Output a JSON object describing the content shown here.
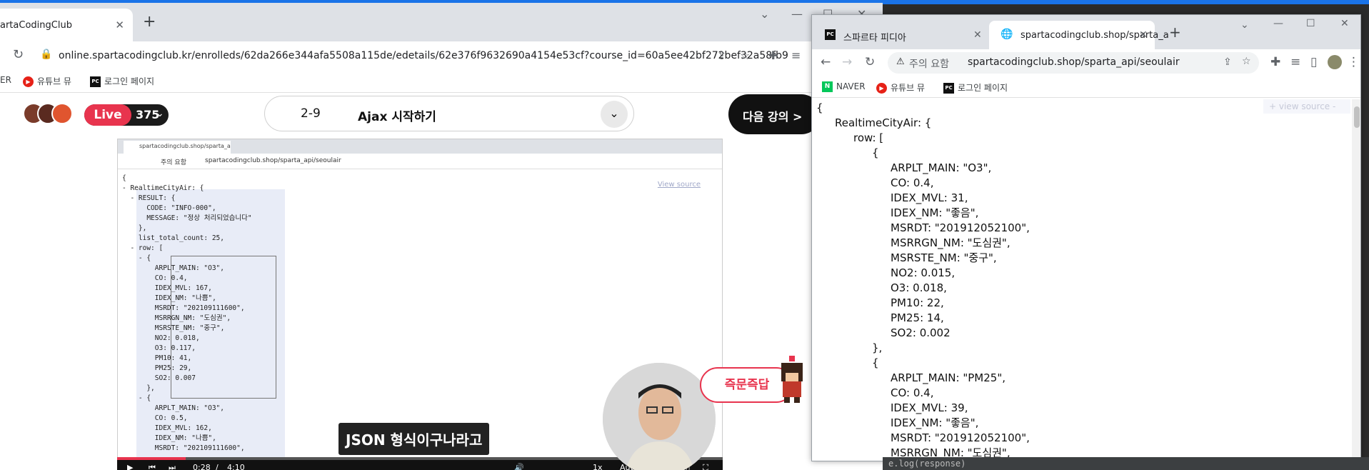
{
  "left_browser": {
    "tab_title": "artaCodingClub",
    "url": "online.spartacodingclub.kr/enrolleds/62da266e344afa5508a115de/edetails/62e376f9632690a4154e53cf?course_id=60a5ee42bf272bef32a58fb9",
    "bookmarks": [
      "ER",
      "유튜브 뮤",
      "로그인 페이지"
    ],
    "live_label": "Live",
    "live_count": "375",
    "lesson_number": "2-9",
    "lesson_title": "Ajax 시작하기",
    "next_button": "다음 강의 >",
    "qa_button": "즉문즉답",
    "caption": "JSON 형식이구나라고",
    "time_current": "0:28",
    "time_separator": "/",
    "time_total": "4:10",
    "speed": "1x",
    "quality": "Auto",
    "progress_fraction": 0.113
  },
  "video_browser": {
    "tab_title": "spartacodingclub.shop/sparta_a",
    "warning": "주의 요함",
    "url": "spartacodingclub.shop/sparta_api/seoulair",
    "view_source": "View source",
    "json_lines": [
      "{",
      "- RealtimeCityAir: {",
      "  - RESULT: {",
      "      CODE: \"INFO-000\",",
      "      MESSAGE: \"정상 처리되었습니다\"",
      "    },",
      "    list_total_count: 25,",
      "  - row: [",
      "    - {",
      "        ARPLT_MAIN: \"O3\",",
      "        CO: 0.4,",
      "        IDEX_MVL: 167,",
      "        IDEX_NM: \"나쁨\",",
      "        MSRDT: \"202109111600\",",
      "        MSRRGN_NM: \"도심권\",",
      "        MSRSTE_NM: \"중구\",",
      "        NO2: 0.018,",
      "        O3: 0.117,",
      "        PM10: 41,",
      "        PM25: 29,",
      "        SO2: 0.007",
      "      },",
      "    - {",
      "        ARPLT_MAIN: \"O3\",",
      "        CO: 0.5,",
      "        IDEX_MVL: 162,",
      "        IDEX_NM: \"나쁨\",",
      "        MSRDT: \"202109111600\","
    ]
  },
  "right_browser": {
    "tabs": [
      "스파르타 피디아",
      "spartacodingclub.shop/sparta_a"
    ],
    "warning": "주의 요함",
    "url": "spartacodingclub.shop/sparta_api/seoulair",
    "bookmarks": [
      "NAVER",
      "유튜브 뮤",
      "로그인 페이지"
    ],
    "view_source": "view source",
    "json_lines": [
      {
        "indent": 0,
        "text": "{"
      },
      {
        "indent": 1,
        "text": "RealtimeCityAir: {"
      },
      {
        "indent": 2,
        "text": "row: ["
      },
      {
        "indent": 3,
        "text": "{"
      },
      {
        "indent": 4,
        "text": "ARPLT_MAIN: \"O3\","
      },
      {
        "indent": 4,
        "text": "CO: 0.4,"
      },
      {
        "indent": 4,
        "text": "IDEX_MVL: 31,"
      },
      {
        "indent": 4,
        "text": "IDEX_NM: \"좋음\","
      },
      {
        "indent": 4,
        "text": "MSRDT: \"201912052100\","
      },
      {
        "indent": 4,
        "text": "MSRRGN_NM: \"도심권\","
      },
      {
        "indent": 4,
        "text": "MSRSTE_NM: \"중구\","
      },
      {
        "indent": 4,
        "text": "NO2: 0.015,"
      },
      {
        "indent": 4,
        "text": "O3: 0.018,"
      },
      {
        "indent": 4,
        "text": "PM10: 22,"
      },
      {
        "indent": 4,
        "text": "PM25: 14,"
      },
      {
        "indent": 4,
        "text": "SO2: 0.002"
      },
      {
        "indent": 3,
        "text": "},"
      },
      {
        "indent": 3,
        "text": "{"
      },
      {
        "indent": 4,
        "text": "ARPLT_MAIN: \"PM25\","
      },
      {
        "indent": 4,
        "text": "CO: 0.4,"
      },
      {
        "indent": 4,
        "text": "IDEX_MVL: 39,"
      },
      {
        "indent": 4,
        "text": "IDEX_NM: \"좋음\","
      },
      {
        "indent": 4,
        "text": "MSRDT: \"201912052100\","
      },
      {
        "indent": 4,
        "text": "MSRRGN_NM: \"도심권\","
      }
    ]
  },
  "console_text": "e.log(response)",
  "colors": {
    "accent": "#e8344e",
    "chrome_tabbar": "#dee1e6"
  }
}
